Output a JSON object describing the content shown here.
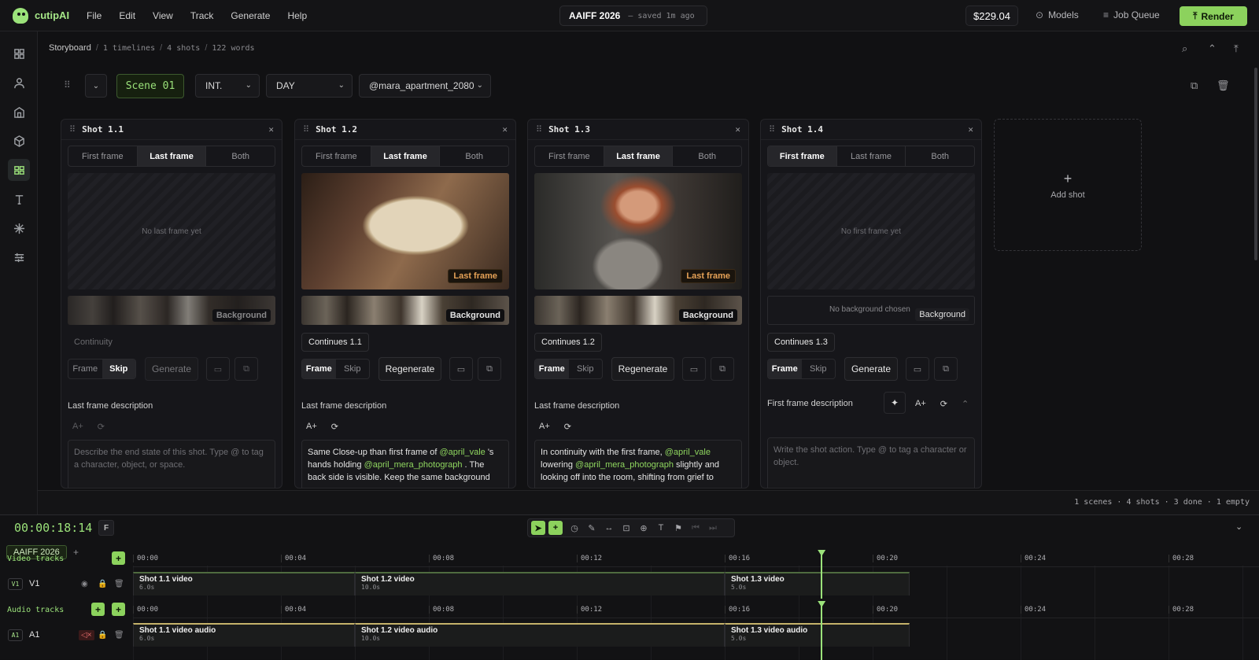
{
  "app": {
    "name": "cutipAI",
    "menu": [
      "File",
      "Edit",
      "View",
      "Track",
      "Generate",
      "Help"
    ]
  },
  "project": {
    "name": "AAIFF 2026",
    "saved": "– saved 1m ago"
  },
  "topright": {
    "balance": "$229.04",
    "models": "Models",
    "job_queue": "Job Queue",
    "render": "Render"
  },
  "breadcrumb": {
    "root": "Storyboard",
    "timelines": "1 timelines",
    "shots": "4 shots",
    "words": "122 words"
  },
  "scene": {
    "label": "Scene 01",
    "int_ext": "INT.",
    "time": "DAY",
    "location": "@mara_apartment_2080"
  },
  "segments": [
    "First frame",
    "Last frame",
    "Both"
  ],
  "labels": {
    "frame": "Frame",
    "skip": "Skip",
    "background": "Background",
    "add_shot": "Add shot",
    "no_bg": "No background chosen",
    "last_tag": "Last frame",
    "auto": "A+"
  },
  "shots": [
    {
      "title": "Shot 1.1",
      "active_seg": 1,
      "empty_text": "No last frame yet",
      "continuity": "Continuity",
      "fs_on": 1,
      "gen": "Generate",
      "desc_label": "Last frame description",
      "desc": "Describe the end state of this shot. Type @ to tag a character, object, or space."
    },
    {
      "title": "Shot 1.2",
      "active_seg": 1,
      "continuity": "Continues 1.1",
      "fs_on": 0,
      "gen": "Regenerate",
      "desc_label": "Last frame description",
      "desc_parts": [
        "Same Close-up than first frame of ",
        "@april_vale",
        " 's hands holding ",
        "@april_mera_photograph",
        " . The back side is visible. Keep the same background"
      ]
    },
    {
      "title": "Shot 1.3",
      "active_seg": 1,
      "continuity": "Continues 1.2",
      "fs_on": 0,
      "gen": "Regenerate",
      "desc_label": "Last frame description",
      "desc_parts": [
        "In continuity with the first frame, ",
        "@april_vale",
        " lowering ",
        "@april_mera_photograph",
        " slightly and looking off into the room, shifting from grief to"
      ]
    },
    {
      "title": "Shot 1.4",
      "active_seg": 0,
      "empty_text": "No first frame yet",
      "continuity": "Continues 1.3",
      "fs_on": 0,
      "gen": "Generate",
      "desc_label": "First frame description",
      "desc": "Write the shot action. Type @ to tag a character or object."
    }
  ],
  "status": "1 scenes · 4 shots · 3 done · 1 empty",
  "timeline": {
    "timecode": "00:00:18:14",
    "frame_btn": "F",
    "project_tab": "AAIFF 2026",
    "video_label": "Video tracks",
    "audio_label": "Audio tracks",
    "ticks": [
      "00:00",
      "00:04",
      "00:08",
      "00:12",
      "00:16",
      "00:20",
      "00:24",
      "00:28"
    ],
    "v1": {
      "badge": "V1",
      "name": "V1"
    },
    "a1": {
      "badge": "A1",
      "name": "A1"
    },
    "video_clips": [
      {
        "name": "Shot 1.1 video",
        "dur": "6.0s"
      },
      {
        "name": "Shot 1.2 video",
        "dur": "10.0s"
      },
      {
        "name": "Shot 1.3 video",
        "dur": "5.0s"
      }
    ],
    "audio_clips": [
      {
        "name": "Shot 1.1 video audio",
        "dur": "6.0s"
      },
      {
        "name": "Shot 1.2 video audio",
        "dur": "10.0s"
      },
      {
        "name": "Shot 1.3 video audio",
        "dur": "5.0s"
      }
    ],
    "playhead_seconds": 18.6
  }
}
